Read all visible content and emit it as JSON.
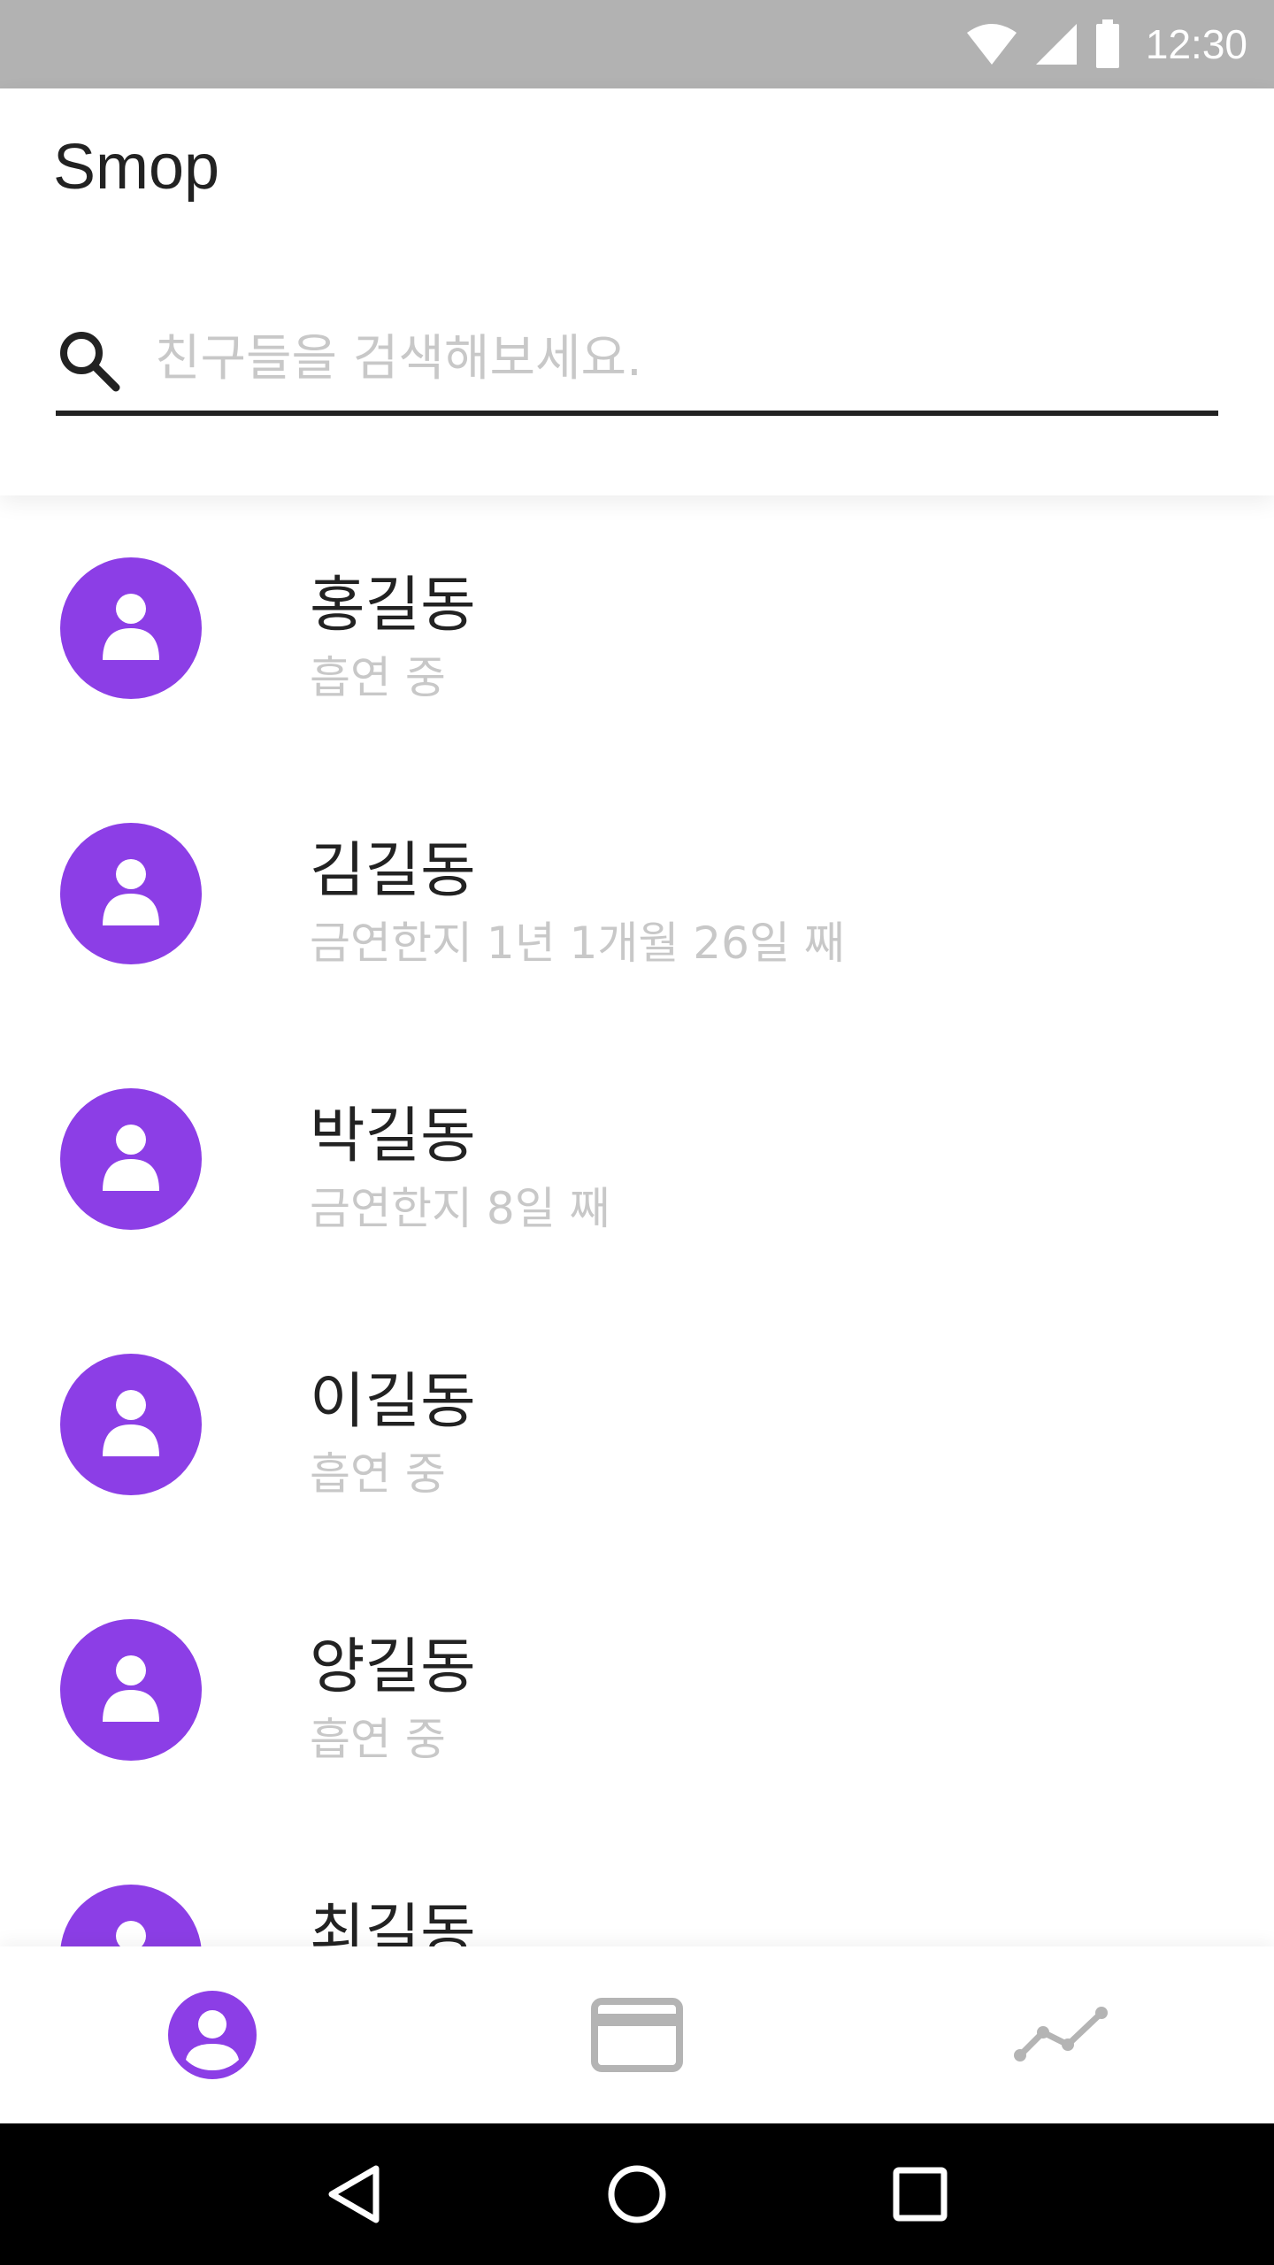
{
  "status_bar": {
    "time": "12:30",
    "icons": [
      "wifi-icon",
      "signal-icon",
      "battery-icon"
    ]
  },
  "header": {
    "title": "Smop",
    "search": {
      "placeholder": "친구들을 검색해보세요.",
      "value": "",
      "icon": "search-icon"
    }
  },
  "friends": [
    {
      "name": "홍길동",
      "status": "흡연 중"
    },
    {
      "name": "김길동",
      "status": "금연한지 1년 1개월 26일 째"
    },
    {
      "name": "박길동",
      "status": "금연한지 8일 째"
    },
    {
      "name": "이길동",
      "status": "흡연 중"
    },
    {
      "name": "양길동",
      "status": "흡연 중"
    },
    {
      "name": "최길동",
      "status": ""
    }
  ],
  "bottom_nav": {
    "items": [
      {
        "icon": "account-circle-icon",
        "active": true
      },
      {
        "icon": "card-icon",
        "active": false
      },
      {
        "icon": "trending-chart-icon",
        "active": false
      }
    ]
  },
  "colors": {
    "accent": "#8c3ee6",
    "status_bar": "#b2b2b2",
    "text_primary": "#222222",
    "text_secondary": "#c8c8c8",
    "nav_inactive": "#b4b4b4"
  }
}
